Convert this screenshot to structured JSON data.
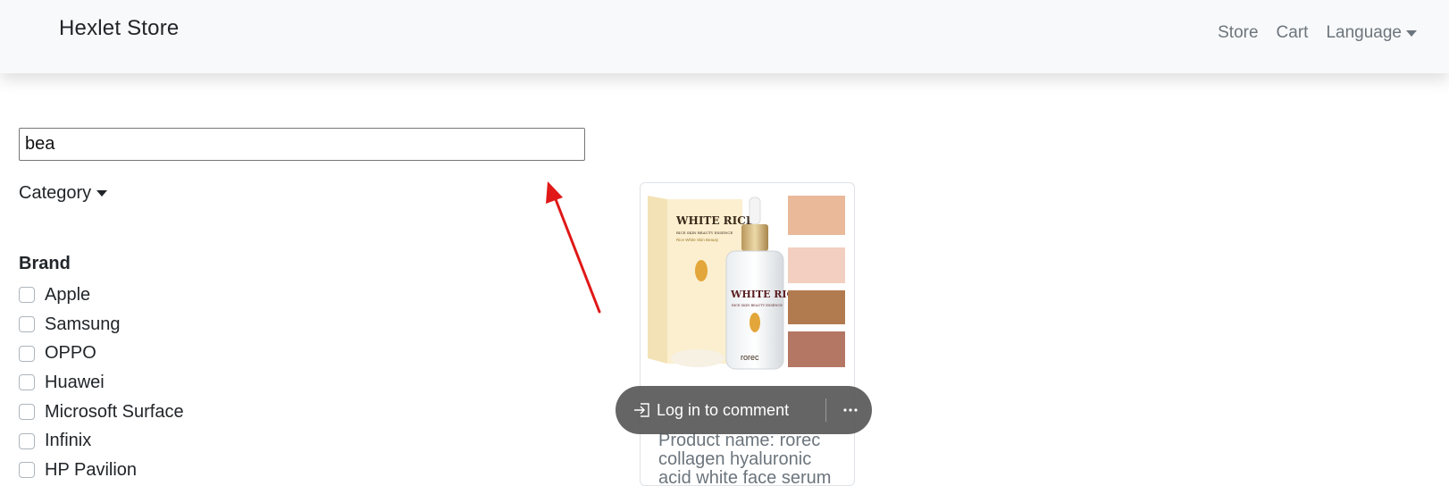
{
  "navbar": {
    "brand": "Hexlet Store",
    "links": [
      {
        "label": "Store"
      },
      {
        "label": "Cart"
      },
      {
        "label": "Language"
      }
    ]
  },
  "search": {
    "value": "bea"
  },
  "filters": {
    "category_label": "Category",
    "brand_heading": "Brand",
    "brands": [
      "Apple",
      "Samsung",
      "OPPO",
      "Huawei",
      "Microsoft Surface",
      "Infinix",
      "HP Pavilion"
    ]
  },
  "product_card": {
    "image_texts": {
      "box_title": "WHITE RICE",
      "box_subtitle": "RICE SKIN BEAUTY ESSENCE",
      "box_tagline": "Rice White Skin Beauty",
      "bottle_title": "WHITE RICE",
      "bottle_subtitle": "RICE SKIN BEAUTY ESSENCE",
      "bottle_brand": "rorec"
    },
    "text": "Product name: rorec collagen hyaluronic acid white face serum"
  },
  "comment_bar": {
    "label": "Log in to comment"
  },
  "colors": {
    "navbar_bg": "#f8f9fa",
    "annotation_arrow": "#e01818",
    "pill_bg": "#585858"
  }
}
